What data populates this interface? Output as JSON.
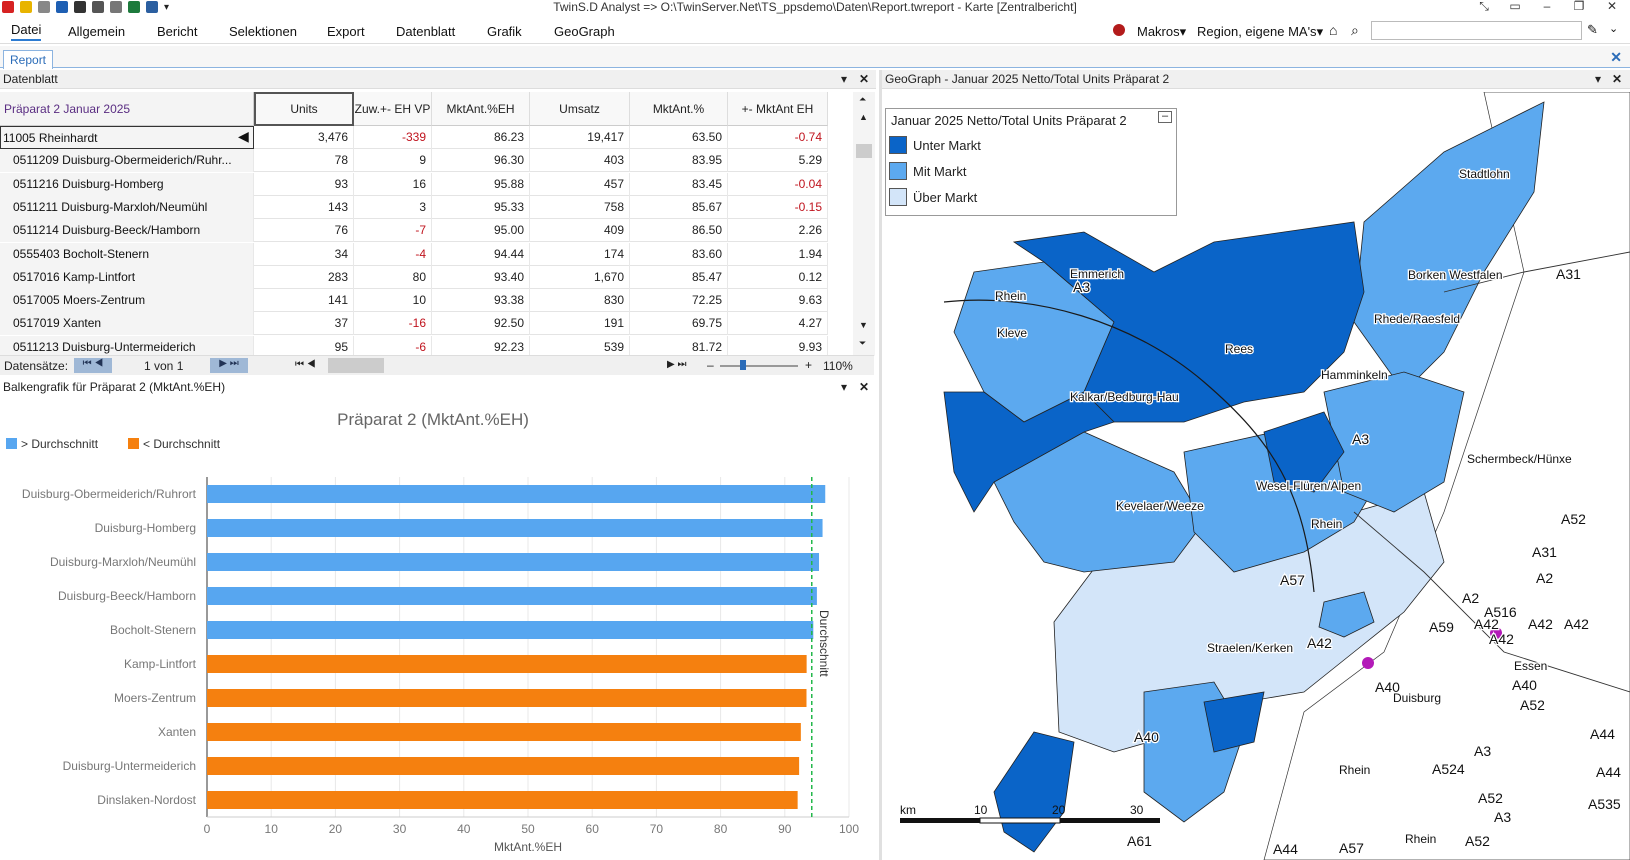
{
  "window": {
    "title": "TwinS.D Analyst => O:\\TwinServer.Net\\TS_ppsdemo\\Daten\\Report.twreport - Karte [Zentralbericht]"
  },
  "menu": [
    "Datei",
    "Allgemein",
    "Bericht",
    "Selektionen",
    "Export",
    "Datenblatt",
    "Grafik",
    "GeoGraph"
  ],
  "menu_right": {
    "macros": "Makros",
    "region": "Region, eigene MA's"
  },
  "doc_tab": "Report",
  "datasheet": {
    "title": "Datenblatt",
    "caption": "Präparat 2 Januar 2025",
    "columns": [
      "Units",
      "Zuw.+- EH VP",
      "MktAnt.%EH",
      "Umsatz",
      "MktAnt.%",
      "+- MktAnt EH"
    ],
    "rows": [
      {
        "name": "11005 Rheinhardt",
        "units": "3,476",
        "zuw": "-339",
        "mkteh": "86.23",
        "umsatz": "19,417",
        "mkt": "63.50",
        "diff": "-0.74"
      },
      {
        "name": "0511209 Duisburg-Obermeiderich/Ruhr...",
        "units": "78",
        "zuw": "9",
        "mkteh": "96.30",
        "umsatz": "403",
        "mkt": "83.95",
        "diff": "5.29"
      },
      {
        "name": "0511216 Duisburg-Homberg",
        "units": "93",
        "zuw": "16",
        "mkteh": "95.88",
        "umsatz": "457",
        "mkt": "83.45",
        "diff": "-0.04"
      },
      {
        "name": "0511211 Duisburg-Marxloh/Neumühl",
        "units": "143",
        "zuw": "3",
        "mkteh": "95.33",
        "umsatz": "758",
        "mkt": "85.67",
        "diff": "-0.15"
      },
      {
        "name": "0511214 Duisburg-Beeck/Hamborn",
        "units": "76",
        "zuw": "-7",
        "mkteh": "95.00",
        "umsatz": "409",
        "mkt": "86.50",
        "diff": "2.26"
      },
      {
        "name": "0555403 Bocholt-Stenern",
        "units": "34",
        "zuw": "-4",
        "mkteh": "94.44",
        "umsatz": "174",
        "mkt": "83.60",
        "diff": "1.94"
      },
      {
        "name": "0517016 Kamp-Lintfort",
        "units": "283",
        "zuw": "80",
        "mkteh": "93.40",
        "umsatz": "1,670",
        "mkt": "85.47",
        "diff": "0.12"
      },
      {
        "name": "0517005 Moers-Zentrum",
        "units": "141",
        "zuw": "10",
        "mkteh": "93.38",
        "umsatz": "830",
        "mkt": "72.25",
        "diff": "9.63"
      },
      {
        "name": "0517019 Xanten",
        "units": "37",
        "zuw": "-16",
        "mkteh": "92.50",
        "umsatz": "191",
        "mkt": "69.75",
        "diff": "4.27"
      },
      {
        "name": "0511213 Duisburg-Untermeiderich",
        "units": "95",
        "zuw": "-6",
        "mkteh": "92.23",
        "umsatz": "539",
        "mkt": "81.72",
        "diff": "9.93"
      }
    ],
    "nav": {
      "label": "Datensätze:",
      "page": "1 von 1",
      "zoom": "110%"
    }
  },
  "chart_panel_title": "Balkengrafik für Präparat 2  (MktAnt.%EH)",
  "chart_data": {
    "type": "bar",
    "orientation": "horizontal",
    "title": "Präparat 2  (MktAnt.%EH)",
    "xlabel": "MktAnt.%EH",
    "xlim": [
      0,
      100
    ],
    "xticks": [
      "0",
      "10",
      "20",
      "30",
      "40",
      "50",
      "60",
      "70",
      "80",
      "90",
      "100"
    ],
    "legend": [
      "> Durchschnitt",
      "< Durchschnitt"
    ],
    "legend_position": "top-left",
    "colors": {
      "above": "#57a6f0",
      "below": "#f5800f",
      "avg_line": "#22b84a"
    },
    "average": {
      "value": 94.2,
      "label": "Durchschnitt"
    },
    "categories": [
      "Duisburg-Obermeiderich/Ruhrort",
      "Duisburg-Homberg",
      "Duisburg-Marxloh/Neumühl",
      "Duisburg-Beeck/Hamborn",
      "Bocholt-Stenern",
      "Kamp-Lintfort",
      "Moers-Zentrum",
      "Xanten",
      "Duisburg-Untermeiderich",
      "Dinslaken-Nordost"
    ],
    "values": [
      96.3,
      95.88,
      95.33,
      95.0,
      94.44,
      93.4,
      93.38,
      92.5,
      92.23,
      92.0
    ],
    "group": [
      "above",
      "above",
      "above",
      "above",
      "above",
      "below",
      "below",
      "below",
      "below",
      "below"
    ],
    "grid": true
  },
  "map": {
    "title": "GeoGraph - Januar 2025 Netto/Total Units Präparat 2",
    "legend_title": "Januar 2025 Netto/Total Units Präparat 2",
    "legend": [
      {
        "label": "Unter Markt",
        "color": "#0a64c8"
      },
      {
        "label": "Mit Markt",
        "color": "#5ca9ef"
      },
      {
        "label": "Über Markt",
        "color": "#d3e5f9"
      }
    ],
    "place_labels": [
      "Stadtlohn",
      "Borken Westfalen",
      "A31",
      "Rhede/Raesfeld",
      "Emmerich",
      "A3",
      "Rhein",
      "Kleve",
      "Rees",
      "Hamminkeln",
      "Kalkar/Bedburg-Hau",
      "A3",
      "Schermbeck/Hünxe",
      "Wesel-Flüren/Alpen",
      "Kevelaer/Weeze",
      "Rhein",
      "A52",
      "A31",
      "A2",
      "A57",
      "A2",
      "A516",
      "A42",
      "A42",
      "A42",
      "A59",
      "A42",
      "Straelen/Kerken",
      "A42",
      "Essen",
      "A40",
      "Duisburg",
      "A40",
      "A52",
      "A40",
      "A44",
      "Rhein",
      "A524",
      "A3",
      "A52",
      "A44",
      "A535",
      "A3",
      "A44",
      "A57",
      "Rhein",
      "A52",
      "A61"
    ],
    "scale": {
      "unit": "km",
      "ticks": [
        "10",
        "20",
        "30"
      ]
    }
  }
}
